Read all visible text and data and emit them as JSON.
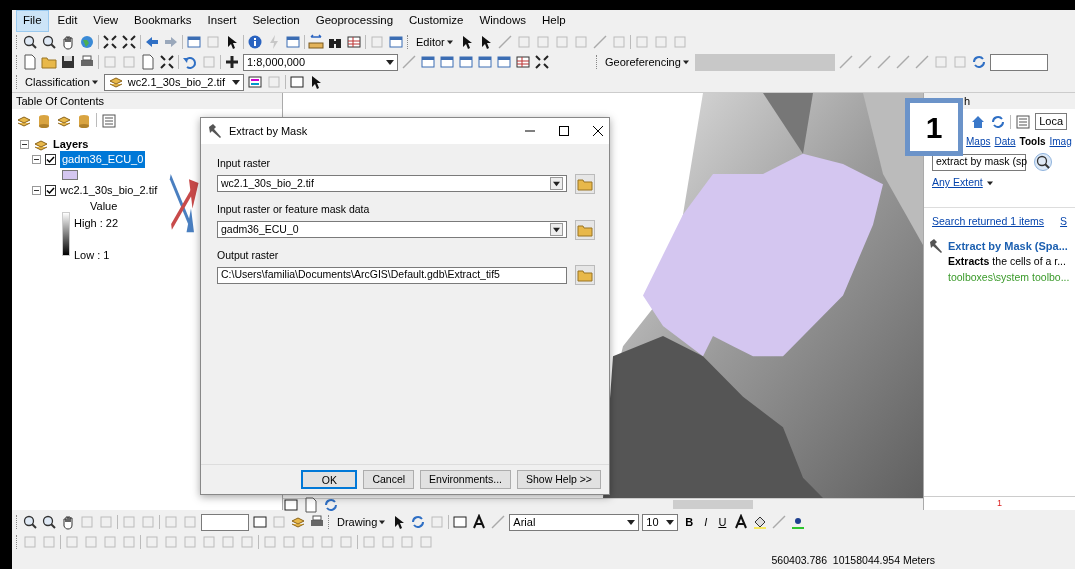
{
  "menu": [
    {
      "label": "File",
      "selected": true
    },
    {
      "label": "Edit",
      "selected": false
    },
    {
      "label": "View",
      "selected": false
    },
    {
      "label": "Bookmarks",
      "selected": false
    },
    {
      "label": "Insert",
      "selected": false
    },
    {
      "label": "Selection",
      "selected": false
    },
    {
      "label": "Geoprocessing",
      "selected": false
    },
    {
      "label": "Customize",
      "selected": false
    },
    {
      "label": "Windows",
      "selected": false
    },
    {
      "label": "Help",
      "selected": false
    }
  ],
  "toolbars": {
    "editor": "Editor",
    "scale": "1:8,000,000",
    "georeferencing": "Georeferencing",
    "classification": "Classification",
    "layer": "wc2.1_30s_bio_2.tif",
    "drawing": "Drawing",
    "font": "Arial",
    "font_size": "10",
    "bold": "B",
    "italic": "I",
    "underline": "U"
  },
  "toc": {
    "title": "Table Of Contents",
    "root": {
      "label": "Layers",
      "expanded": true,
      "children": [
        {
          "label": "gadm36_ECU_0",
          "expanded": true,
          "checked": true,
          "selected": true,
          "legend": {
            "kind": "swatch",
            "color": "#d4c6f0"
          }
        },
        {
          "label": "wc2.1_30s_bio_2.tif",
          "expanded": true,
          "checked": true,
          "selected": false,
          "legend": {
            "kind": "ramp",
            "heading": "Value",
            "high": "High : 22",
            "low": "Low : 1"
          }
        }
      ]
    }
  },
  "dialog": {
    "title": "Extract by Mask",
    "fields": [
      {
        "kind": "combo",
        "label": "Input raster",
        "value": "wc2.1_30s_bio_2.tif"
      },
      {
        "kind": "combo",
        "label": "Input raster or feature mask data",
        "value": "gadm36_ECU_0"
      },
      {
        "kind": "text",
        "label": "Output raster",
        "value": "C:\\Users\\familia\\Documents\\ArcGIS\\Default.gdb\\Extract_tif5"
      }
    ],
    "buttons": [
      {
        "label": "OK",
        "default": true
      },
      {
        "label": "Cancel",
        "default": false
      },
      {
        "label": "Environments...",
        "default": false
      },
      {
        "label": "Show Help >>",
        "default": false
      }
    ]
  },
  "search": {
    "title_fragment": "h",
    "location": "Loca",
    "tabs": [
      {
        "label": "Maps",
        "selected": false
      },
      {
        "label": "Data",
        "selected": false
      },
      {
        "label": "Tools",
        "selected": true
      },
      {
        "label": "Imag",
        "selected": false
      }
    ],
    "query": "extract by mask (sp",
    "extent": "Any Extent",
    "summary": "Search returned 1 items",
    "sort_fragment": "S",
    "results": [
      {
        "title": "Extract by Mask (Spa...",
        "description": "**Extracts** the cells of a r...",
        "path": "toolboxes\\system toolbo..."
      }
    ],
    "page": "1"
  },
  "annotation": "1",
  "status_bar": "560403.786  10158044.954 Meters"
}
